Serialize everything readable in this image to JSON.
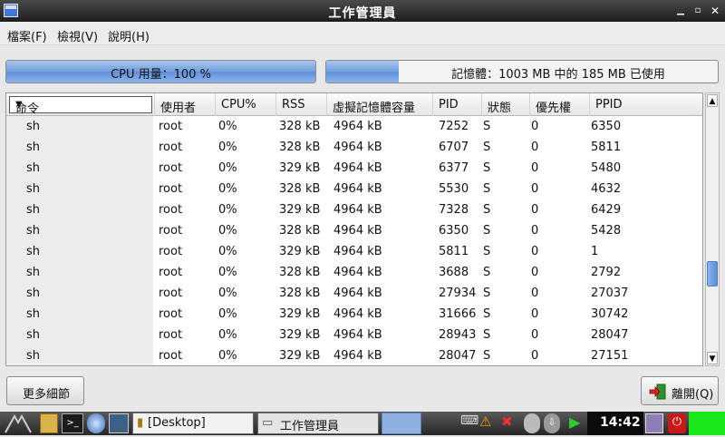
{
  "window": {
    "title": "工作管理員"
  },
  "menu": [
    "檔案(F)",
    "檢視(V)",
    "說明(H)"
  ],
  "cpu": {
    "label": "CPU 用量：100 %",
    "percent": 100
  },
  "memory": {
    "label": "記憶體：1003 MB 中的 185 MB 已使用",
    "used_mb": 185,
    "total_mb": 1003
  },
  "table": {
    "command_select": "命令",
    "headers": [
      "使用者",
      "CPU%",
      "RSS",
      "虛擬記憶體容量",
      "PID",
      "狀態",
      "優先權",
      "PPID"
    ],
    "rows": [
      [
        "sh",
        "root",
        "0%",
        "328 kB",
        "4964 kB",
        "7252",
        "S",
        "0",
        "6350"
      ],
      [
        "sh",
        "root",
        "0%",
        "328 kB",
        "4964 kB",
        "6707",
        "S",
        "0",
        "5811"
      ],
      [
        "sh",
        "root",
        "0%",
        "329 kB",
        "4964 kB",
        "6377",
        "S",
        "0",
        "5480"
      ],
      [
        "sh",
        "root",
        "0%",
        "328 kB",
        "4964 kB",
        "5530",
        "S",
        "0",
        "4632"
      ],
      [
        "sh",
        "root",
        "0%",
        "329 kB",
        "4964 kB",
        "7328",
        "S",
        "0",
        "6429"
      ],
      [
        "sh",
        "root",
        "0%",
        "328 kB",
        "4964 kB",
        "6350",
        "S",
        "0",
        "5428"
      ],
      [
        "sh",
        "root",
        "0%",
        "329 kB",
        "4964 kB",
        "5811",
        "S",
        "0",
        "1"
      ],
      [
        "sh",
        "root",
        "0%",
        "328 kB",
        "4964 kB",
        "3688",
        "S",
        "0",
        "2792"
      ],
      [
        "sh",
        "root",
        "0%",
        "328 kB",
        "4964 kB",
        "27934",
        "S",
        "0",
        "27037"
      ],
      [
        "sh",
        "root",
        "0%",
        "329 kB",
        "4964 kB",
        "31666",
        "S",
        "0",
        "30742"
      ],
      [
        "sh",
        "root",
        "0%",
        "329 kB",
        "4964 kB",
        "28943",
        "S",
        "0",
        "28047"
      ],
      [
        "sh",
        "root",
        "0%",
        "329 kB",
        "4964 kB",
        "28047",
        "S",
        "0",
        "27151"
      ]
    ]
  },
  "buttons": {
    "details": "更多細節",
    "close": "離開(Q)"
  },
  "taskbar": {
    "desktop_label": "[Desktop]",
    "taskmgr_label": "工作管理員",
    "clock": "14:42"
  },
  "colors": {
    "titlebar": "#2e2e2e",
    "bar_fill": "#6f9ede",
    "taskbar": "#2a2a2a",
    "green_indicator": "#19e619"
  }
}
